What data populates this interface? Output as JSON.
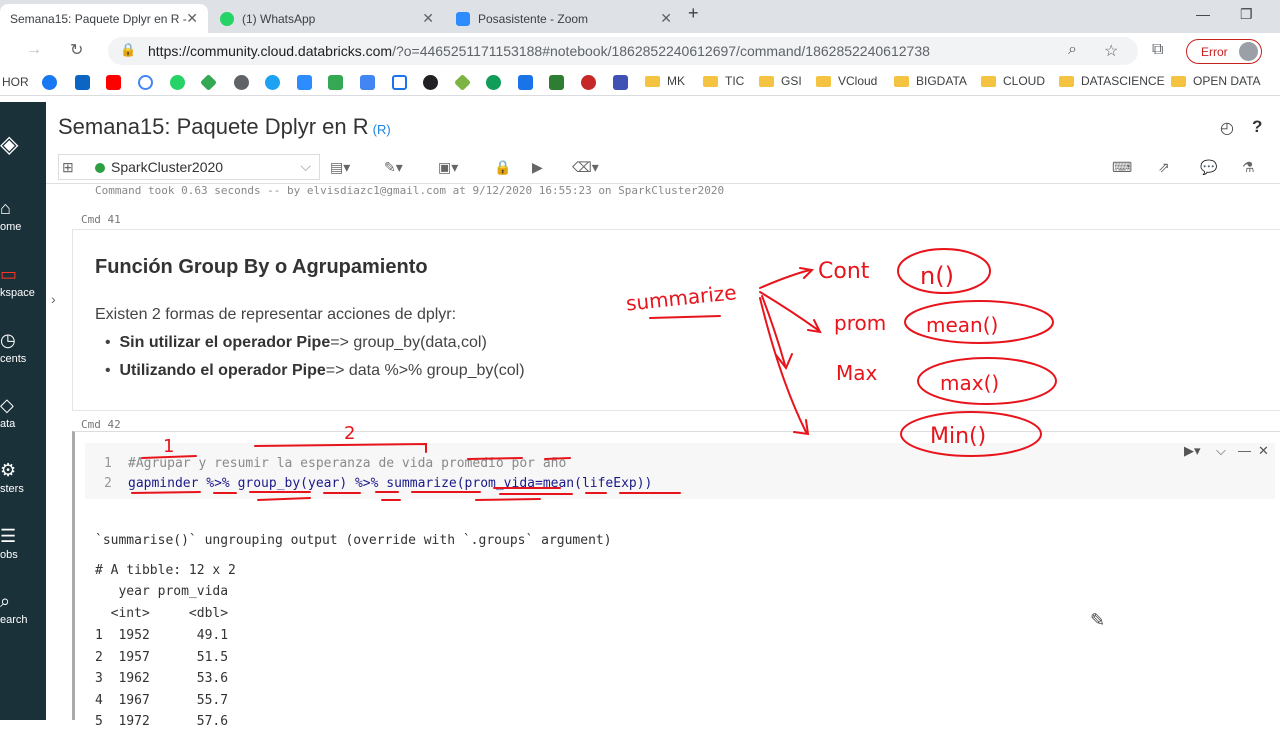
{
  "browser": {
    "tabs": [
      {
        "title": "Semana15: Paquete Dplyr en R -",
        "active": true,
        "icon_color": "#ff3621"
      },
      {
        "title": "(1) WhatsApp",
        "active": false,
        "icon_color": "#25d366"
      },
      {
        "title": "Posasistente - Zoom",
        "active": false,
        "icon_color": "#2d8cff"
      }
    ],
    "new_tab": "+",
    "url_host": "https://community.cloud.databricks.com",
    "url_rest": "/?o=4465251171153188#notebook/1862852240612697/command/1862852240612738",
    "error_label": "Error",
    "bookmarks_lead": "HOR",
    "bookmark_folders": [
      "MK",
      "TIC",
      "GSI",
      "VCloud",
      "BIGDATA",
      "CLOUD",
      "DATASCIENCE",
      "OPEN DATA"
    ]
  },
  "sidebar": {
    "items": [
      "ome",
      "kspace",
      "cents",
      "ata",
      "sters",
      "obs",
      "earch"
    ]
  },
  "notebook": {
    "title": "Semana15: Paquete Dplyr en R",
    "lang": "(R)",
    "cluster": "SparkCluster2020"
  },
  "cells": {
    "prev_took": "Command took 0.63 seconds -- by elvisdiazc1@gmail.com at 9/12/2020 16:55:23 on SparkCluster2020",
    "cmd41": "Cmd 41",
    "cmd42": "Cmd 42",
    "md_heading": "Función Group By o Agrupamiento",
    "md_para": "Existen 2 formas de representar acciones de dplyr:",
    "md_li1_bold": "Sin utilizar el operador Pipe",
    "md_li1_rest": "=> group_by(data,col)",
    "md_li2_bold": "Utilizando el operador Pipe",
    "md_li2_rest": "=> data %>% group_by(col)",
    "code_ln1": "1",
    "code_ln2": "2",
    "code_line1": "#Agrupar y resumir la esperanza de vida promedio por año",
    "code_line2": "gapminder %>% group_by(year) %>% summarize(prom_vida=mean(lifeExp))",
    "out_msg": "`summarise()` ungrouping output (override with `.groups` argument)",
    "out_tibble": "# A tibble: 12 x 2",
    "out_header": "   year prom_vida",
    "out_types": "  <int>     <dbl>",
    "out_rows": [
      "1  1952      49.1",
      "2  1957      51.5",
      "3  1962      53.6",
      "4  1967      55.7",
      "5  1972      57.6"
    ]
  },
  "annotations": {
    "summarize": "summarize",
    "cont": "Cont",
    "prom": "prom",
    "max": "Max",
    "n": "n()",
    "mean": "mean()",
    "maxf": "max()",
    "min": "Min()",
    "num1": "1",
    "num2": "2",
    "ink_color": "#e8141c"
  }
}
